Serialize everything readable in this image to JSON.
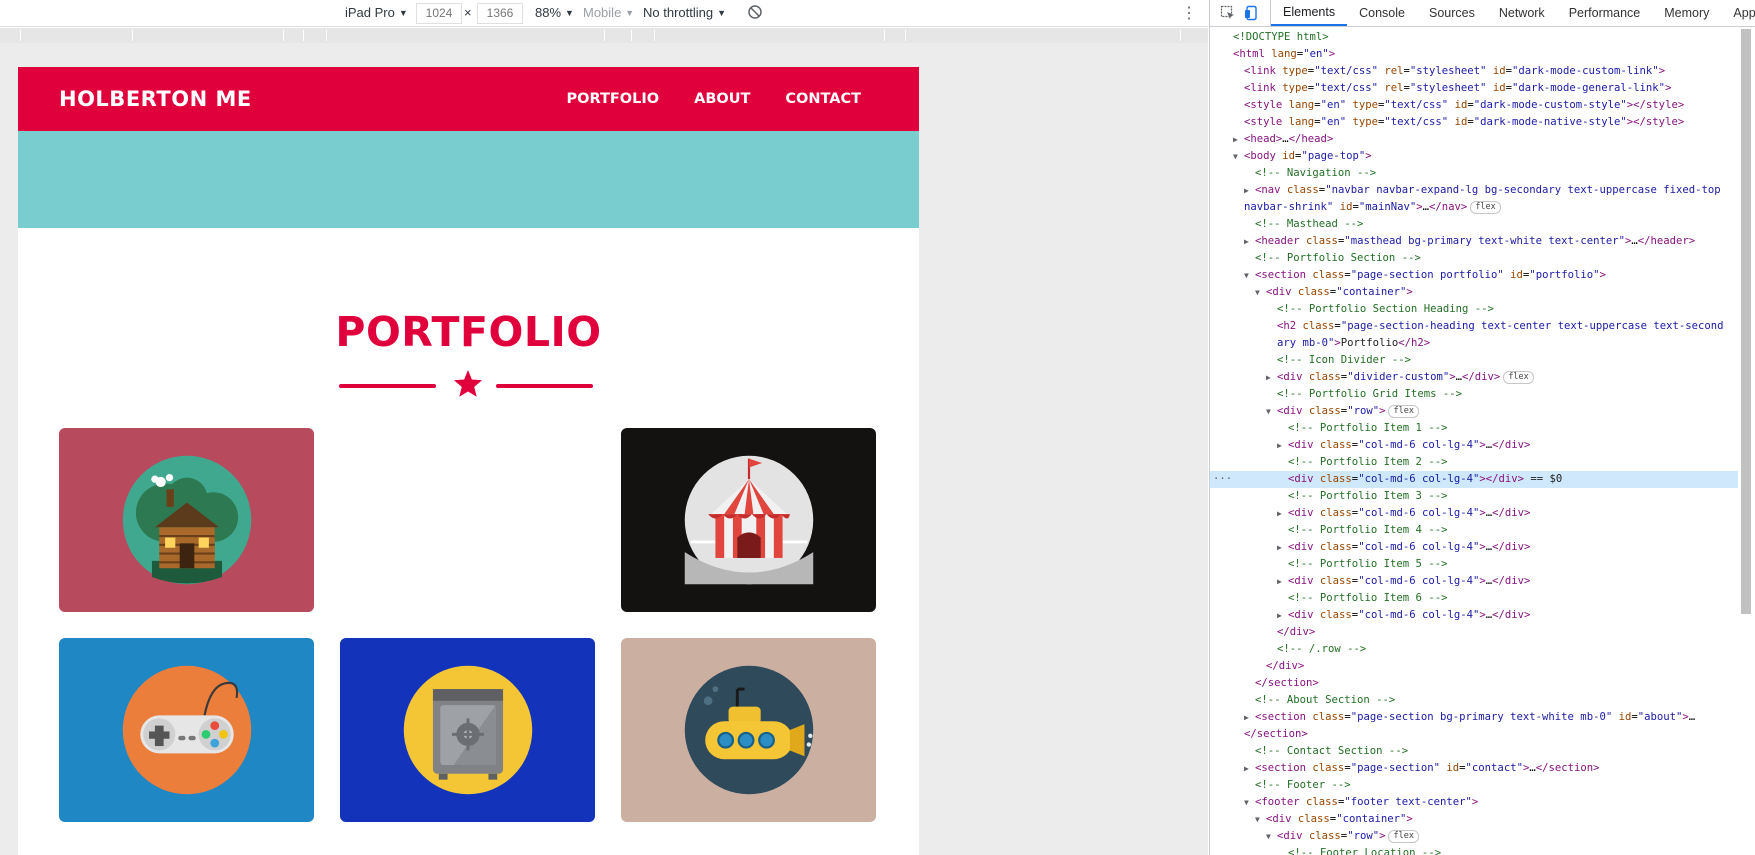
{
  "device_toolbar": {
    "device": "iPad Pro",
    "width": "1024",
    "times": "×",
    "height": "1366",
    "zoom": "88%",
    "mode": "Mobile",
    "throttling": "No throttling"
  },
  "page": {
    "brand": "HOLBERTON ME",
    "nav": [
      "PORTFOLIO",
      "ABOUT",
      "CONTACT"
    ],
    "section_title": "PORTFOLIO",
    "colors": {
      "primary": "#e0003c",
      "masthead": "#79cdcf"
    },
    "portfolio_items": [
      {
        "icon": "log-cabin-icon",
        "bg": "#b84a5e"
      },
      {
        "icon": "empty",
        "bg": "#ffffff"
      },
      {
        "icon": "circus-tent-icon",
        "bg": "#141111"
      },
      {
        "icon": "game-controller-icon",
        "bg": "#1f87c4"
      },
      {
        "icon": "safe-icon",
        "bg": "#1333bb"
      },
      {
        "icon": "submarine-icon",
        "bg": "#cbb0a2"
      }
    ]
  },
  "devtools": {
    "tabs": [
      "Elements",
      "Console",
      "Sources",
      "Network",
      "Performance",
      "Memory",
      "Applic"
    ],
    "active_tab": "Elements",
    "lines": [
      {
        "i": 0,
        "tri": "",
        "html": "<span class='c'>&lt;!DOCTYPE html&gt;</span>"
      },
      {
        "i": 0,
        "tri": "",
        "html": "<span class='t'>&lt;html</span> <span class='a'>lang</span>=<span class='v'>\"en\"</span><span class='t'>&gt;</span>"
      },
      {
        "i": 1,
        "tri": "",
        "html": "<span class='t'>&lt;link</span> <span class='a'>type</span>=<span class='v'>\"text/css\"</span> <span class='a'>rel</span>=<span class='v'>\"stylesheet\"</span> <span class='a'>id</span>=<span class='v'>\"dark-mode-custom-link\"</span><span class='t'>&gt;</span>"
      },
      {
        "i": 1,
        "tri": "",
        "html": "<span class='t'>&lt;link</span> <span class='a'>type</span>=<span class='v'>\"text/css\"</span> <span class='a'>rel</span>=<span class='v'>\"stylesheet\"</span> <span class='a'>id</span>=<span class='v'>\"dark-mode-general-link\"</span><span class='t'>&gt;</span>"
      },
      {
        "i": 1,
        "tri": "",
        "html": "<span class='t'>&lt;style</span> <span class='a'>lang</span>=<span class='v'>\"en\"</span> <span class='a'>type</span>=<span class='v'>\"text/css\"</span> <span class='a'>id</span>=<span class='v'>\"dark-mode-custom-style\"</span><span class='t'>&gt;&lt;/style&gt;</span>"
      },
      {
        "i": 1,
        "tri": "",
        "html": "<span class='t'>&lt;style</span> <span class='a'>lang</span>=<span class='v'>\"en\"</span> <span class='a'>type</span>=<span class='v'>\"text/css\"</span> <span class='a'>id</span>=<span class='v'>\"dark-mode-native-style\"</span><span class='t'>&gt;&lt;/style&gt;</span>"
      },
      {
        "i": 1,
        "tri": "▶",
        "html": "<span class='t'>&lt;head&gt;</span>…<span class='t'>&lt;/head&gt;</span>"
      },
      {
        "i": 1,
        "tri": "▼",
        "html": "<span class='t'>&lt;body</span> <span class='a'>id</span>=<span class='v'>\"page-top\"</span><span class='t'>&gt;</span>"
      },
      {
        "i": 2,
        "tri": "",
        "html": "<span class='c'>&lt;!-- Navigation --&gt;</span>"
      },
      {
        "i": 2,
        "tri": "▶",
        "html": "<span class='t'>&lt;nav</span> <span class='a'>class</span>=<span class='v'>\"navbar navbar-expand-lg bg-secondary text-uppercase fixed-top</span>"
      },
      {
        "i": 1,
        "tri": "",
        "html": "<span class='v'>navbar-shrink\"</span> <span class='a'>id</span>=<span class='v'>\"mainNav\"</span><span class='t'>&gt;</span>…<span class='t'>&lt;/nav&gt;</span><span class='badge'>flex</span>"
      },
      {
        "i": 2,
        "tri": "",
        "html": "<span class='c'>&lt;!-- Masthead --&gt;</span>"
      },
      {
        "i": 2,
        "tri": "▶",
        "html": "<span class='t'>&lt;header</span> <span class='a'>class</span>=<span class='v'>\"masthead bg-primary text-white text-center\"</span><span class='t'>&gt;</span>…<span class='t'>&lt;/header&gt;</span>"
      },
      {
        "i": 2,
        "tri": "",
        "html": "<span class='c'>&lt;!-- Portfolio Section --&gt;</span>"
      },
      {
        "i": 2,
        "tri": "▼",
        "html": "<span class='t'>&lt;section</span> <span class='a'>class</span>=<span class='v'>\"page-section portfolio\"</span> <span class='a'>id</span>=<span class='v'>\"portfolio\"</span><span class='t'>&gt;</span>"
      },
      {
        "i": 3,
        "tri": "▼",
        "html": "<span class='t'>&lt;div</span> <span class='a'>class</span>=<span class='v'>\"container\"</span><span class='t'>&gt;</span>"
      },
      {
        "i": 4,
        "tri": "",
        "html": "<span class='c'>&lt;!-- Portfolio Section Heading --&gt;</span>"
      },
      {
        "i": 4,
        "tri": "",
        "html": "<span class='t'>&lt;h2</span> <span class='a'>class</span>=<span class='v'>\"page-section-heading text-center text-uppercase text-second</span>"
      },
      {
        "i": 4,
        "tri": "",
        "html": "<span class='v'>ary mb-0\"</span><span class='t'>&gt;</span><span class='x'>Portfolio</span><span class='t'>&lt;/h2&gt;</span>"
      },
      {
        "i": 4,
        "tri": "",
        "html": "<span class='c'>&lt;!-- Icon Divider --&gt;</span>"
      },
      {
        "i": 4,
        "tri": "▶",
        "html": "<span class='t'>&lt;div</span> <span class='a'>class</span>=<span class='v'>\"divider-custom\"</span><span class='t'>&gt;</span>…<span class='t'>&lt;/div&gt;</span><span class='badge'>flex</span>"
      },
      {
        "i": 4,
        "tri": "",
        "html": "<span class='c'>&lt;!-- Portfolio Grid Items --&gt;</span>"
      },
      {
        "i": 4,
        "tri": "▼",
        "html": "<span class='t'>&lt;div</span> <span class='a'>class</span>=<span class='v'>\"row\"</span><span class='t'>&gt;</span><span class='badge'>flex</span>"
      },
      {
        "i": 5,
        "tri": "",
        "html": "<span class='c'>&lt;!-- Portfolio Item 1 --&gt;</span>"
      },
      {
        "i": 5,
        "tri": "▶",
        "html": "<span class='t'>&lt;div</span> <span class='a'>class</span>=<span class='v'>\"col-md-6 col-lg-4\"</span><span class='t'>&gt;</span>…<span class='t'>&lt;/div&gt;</span>"
      },
      {
        "i": 5,
        "tri": "",
        "html": "<span class='c'>&lt;!-- Portfolio Item 2 --&gt;</span>"
      },
      {
        "i": 5,
        "tri": "",
        "sel": true,
        "html": "<span class='t'>&lt;div</span> <span class='a'>class</span>=<span class='v'>\"col-md-6 col-lg-4\"</span><span class='t'>&gt;&lt;/div&gt;</span> <span class='x'>== $0</span>"
      },
      {
        "i": 5,
        "tri": "",
        "html": "<span class='c'>&lt;!-- Portfolio Item 3 --&gt;</span>"
      },
      {
        "i": 5,
        "tri": "▶",
        "html": "<span class='t'>&lt;div</span> <span class='a'>class</span>=<span class='v'>\"col-md-6 col-lg-4\"</span><span class='t'>&gt;</span>…<span class='t'>&lt;/div&gt;</span>"
      },
      {
        "i": 5,
        "tri": "",
        "html": "<span class='c'>&lt;!-- Portfolio Item 4 --&gt;</span>"
      },
      {
        "i": 5,
        "tri": "▶",
        "html": "<span class='t'>&lt;div</span> <span class='a'>class</span>=<span class='v'>\"col-md-6 col-lg-4\"</span><span class='t'>&gt;</span>…<span class='t'>&lt;/div&gt;</span>"
      },
      {
        "i": 5,
        "tri": "",
        "html": "<span class='c'>&lt;!-- Portfolio Item 5 --&gt;</span>"
      },
      {
        "i": 5,
        "tri": "▶",
        "html": "<span class='t'>&lt;div</span> <span class='a'>class</span>=<span class='v'>\"col-md-6 col-lg-4\"</span><span class='t'>&gt;</span>…<span class='t'>&lt;/div&gt;</span>"
      },
      {
        "i": 5,
        "tri": "",
        "html": "<span class='c'>&lt;!-- Portfolio Item 6 --&gt;</span>"
      },
      {
        "i": 5,
        "tri": "▶",
        "html": "<span class='t'>&lt;div</span> <span class='a'>class</span>=<span class='v'>\"col-md-6 col-lg-4\"</span><span class='t'>&gt;</span>…<span class='t'>&lt;/div&gt;</span>"
      },
      {
        "i": 4,
        "tri": "",
        "html": "<span class='t'>&lt;/div&gt;</span>"
      },
      {
        "i": 4,
        "tri": "",
        "html": "<span class='c'>&lt;!-- /.row --&gt;</span>"
      },
      {
        "i": 3,
        "tri": "",
        "html": "<span class='t'>&lt;/div&gt;</span>"
      },
      {
        "i": 2,
        "tri": "",
        "html": "<span class='t'>&lt;/section&gt;</span>"
      },
      {
        "i": 2,
        "tri": "",
        "html": "<span class='c'>&lt;!-- About Section --&gt;</span>"
      },
      {
        "i": 2,
        "tri": "▶",
        "html": "<span class='t'>&lt;section</span> <span class='a'>class</span>=<span class='v'>\"page-section bg-primary text-white mb-0\"</span> <span class='a'>id</span>=<span class='v'>\"about\"</span><span class='t'>&gt;</span>…"
      },
      {
        "i": 1,
        "tri": "",
        "html": "<span class='t'>&lt;/section&gt;</span>"
      },
      {
        "i": 2,
        "tri": "",
        "html": "<span class='c'>&lt;!-- Contact Section --&gt;</span>"
      },
      {
        "i": 2,
        "tri": "▶",
        "html": "<span class='t'>&lt;section</span> <span class='a'>class</span>=<span class='v'>\"page-section\"</span> <span class='a'>id</span>=<span class='v'>\"contact\"</span><span class='t'>&gt;</span>…<span class='t'>&lt;/section&gt;</span>"
      },
      {
        "i": 2,
        "tri": "",
        "html": "<span class='c'>&lt;!-- Footer --&gt;</span>"
      },
      {
        "i": 2,
        "tri": "▼",
        "html": "<span class='t'>&lt;footer</span> <span class='a'>class</span>=<span class='v'>\"footer text-center\"</span><span class='t'>&gt;</span>"
      },
      {
        "i": 3,
        "tri": "▼",
        "html": "<span class='t'>&lt;div</span> <span class='a'>class</span>=<span class='v'>\"container\"</span><span class='t'>&gt;</span>"
      },
      {
        "i": 4,
        "tri": "▼",
        "html": "<span class='t'>&lt;div</span> <span class='a'>class</span>=<span class='v'>\"row\"</span><span class='t'>&gt;</span><span class='badge'>flex</span>"
      },
      {
        "i": 5,
        "tri": "",
        "html": "<span class='c'>&lt;!-- Footer Location --&gt;</span>"
      }
    ]
  }
}
